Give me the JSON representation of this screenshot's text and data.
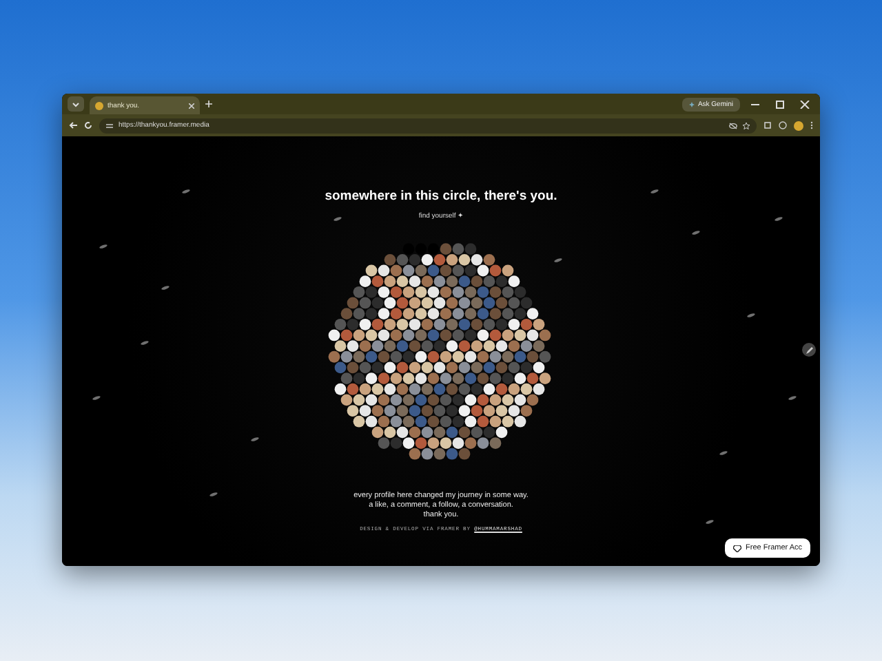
{
  "browser": {
    "tab": {
      "title": "thank you.",
      "selected": true
    },
    "ask_button": "Ask Gemini",
    "url": "https://thankyou.framer.media"
  },
  "page": {
    "heading": "somewhere in this circle, there's you.",
    "find_link": "find yourself ✦",
    "message": [
      "every profile here changed my journey in some way.",
      "a like, a comment, a follow, a conversation.",
      "thank you."
    ],
    "credit": "DESIGN & DEVELOP VIA FRAMER BY",
    "credit_link": "@HUMMAMARSHAD",
    "badge": "Free Framer Acc"
  }
}
